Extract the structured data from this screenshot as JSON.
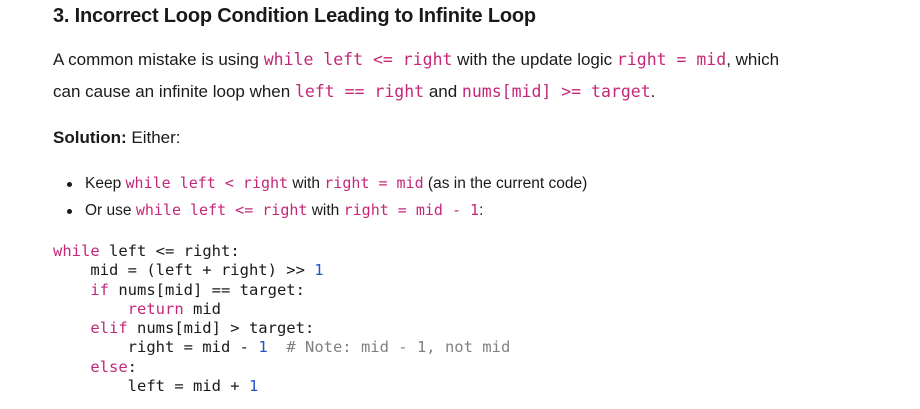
{
  "heading": "3. Incorrect Loop Condition Leading to Infinite Loop",
  "paragraph": {
    "t1": "A common mistake is using ",
    "c1": "while left <= right",
    "t2": " with the update logic ",
    "c2": "right = mid",
    "t3": ", which",
    "t4": "can cause an infinite loop when ",
    "c3": "left == right",
    "t5": " and ",
    "c4": "nums[mid] >= target",
    "t6": "."
  },
  "solution": {
    "label": "Solution:",
    "text": " Either:"
  },
  "bullets": [
    {
      "t1": "Keep ",
      "c1": "while left < right",
      "t2": " with ",
      "c2": "right = mid",
      "t3": " (as in the current code)"
    },
    {
      "t1": "Or use ",
      "c1": "while left <= right",
      "t2": " with ",
      "c2": "right = mid - 1",
      "t3": ":"
    }
  ],
  "code": {
    "l1_kw": "while",
    "l1_rest": " left <= right:",
    "l2_a": "    mid = (left + right) >> ",
    "l2_num": "1",
    "l3_kw": "    if",
    "l3_rest": " nums[mid] == target:",
    "l4_kw": "        return",
    "l4_rest": " mid",
    "l5_kw": "    elif",
    "l5_rest": " nums[mid] > target:",
    "l6_a": "        right = mid - ",
    "l6_num": "1",
    "l6_cmt": "  # Note: mid - 1, not mid",
    "l7_kw": "    else",
    "l7_rest": ":",
    "l8_a": "        left = mid + ",
    "l8_num": "1"
  }
}
